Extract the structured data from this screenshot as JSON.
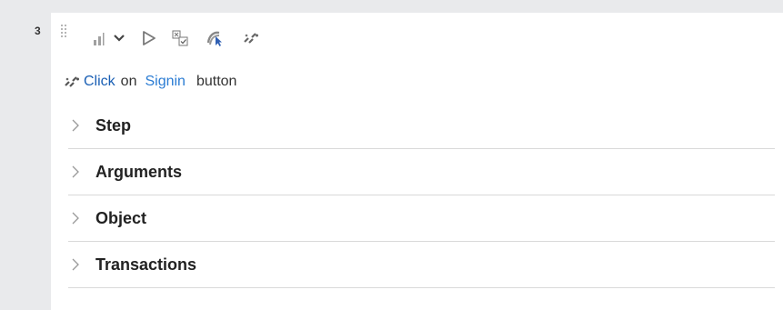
{
  "step": {
    "number": "3"
  },
  "toolbar": {
    "items": [
      {
        "icon": "bar-chart-icon"
      },
      {
        "icon": "chevron-down-icon"
      },
      {
        "icon": "play-icon"
      },
      {
        "icon": "checkbox-list-icon"
      },
      {
        "icon": "cursor-highlight-icon"
      },
      {
        "icon": "action-link-icon"
      }
    ]
  },
  "action": {
    "icon": "action-link-icon",
    "verb": "Click",
    "preposition": "on",
    "target": "Signin",
    "object_type": "button"
  },
  "sections": [
    {
      "label": "Step"
    },
    {
      "label": "Arguments"
    },
    {
      "label": "Object"
    },
    {
      "label": "Transactions"
    }
  ],
  "colors": {
    "link": "#2b7cd3",
    "action": "#1a5fb4",
    "icon_gray": "#8a8a8a",
    "divider": "#d9d9d9",
    "background": "#e9eaec"
  }
}
